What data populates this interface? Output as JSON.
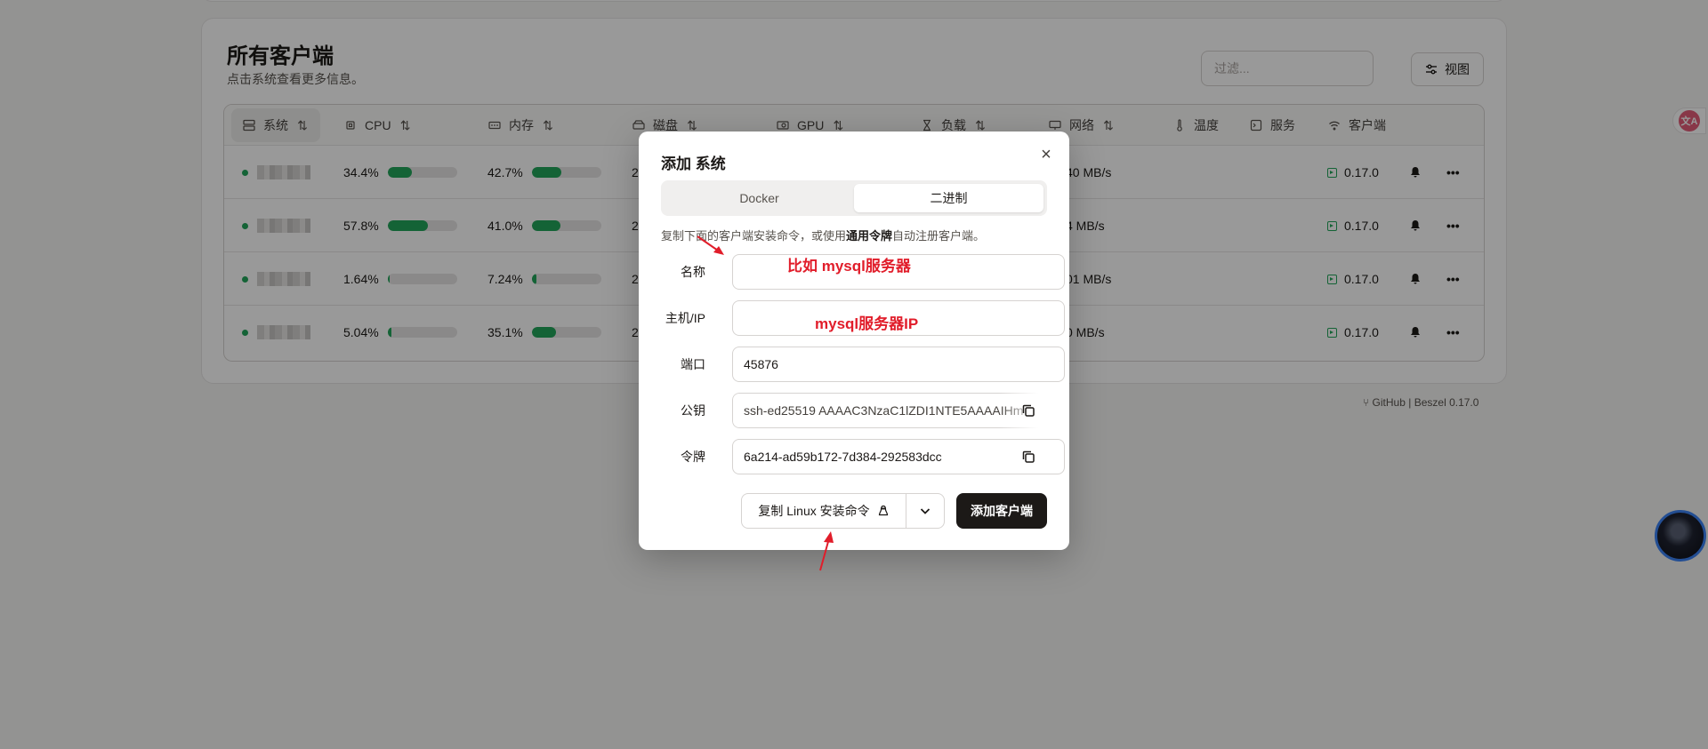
{
  "page": {
    "title": "所有客户端",
    "subtitle": "点击系统查看更多信息。",
    "filter_placeholder": "过滤...",
    "view_label": "视图"
  },
  "table": {
    "headers": [
      {
        "label": "系统",
        "icon": "server-icon",
        "sortable": true
      },
      {
        "label": "CPU",
        "icon": "cpu-icon",
        "sortable": true
      },
      {
        "label": "内存",
        "icon": "memory-icon",
        "sortable": true
      },
      {
        "label": "磁盘",
        "icon": "disk-icon",
        "sortable": true
      },
      {
        "label": "GPU",
        "icon": "gpu-icon",
        "sortable": true
      },
      {
        "label": "负载",
        "icon": "hourglass-icon",
        "sortable": true
      },
      {
        "label": "网络",
        "icon": "network-icon",
        "sortable": true
      },
      {
        "label": "温度",
        "icon": "thermometer-icon",
        "sortable": false
      },
      {
        "label": "服务",
        "icon": "service-icon",
        "sortable": false
      },
      {
        "label": "客户端",
        "icon": "wifi-icon",
        "sortable": false
      }
    ],
    "rows": [
      {
        "cpu": "34.4%",
        "cpu_pct": 34.4,
        "mem": "42.7%",
        "mem_pct": 42.7,
        "disk": "2",
        "net": "40 MB/s",
        "version": "0.17.0"
      },
      {
        "cpu": "57.8%",
        "cpu_pct": 57.8,
        "mem": "41.0%",
        "mem_pct": 41.0,
        "disk": "2",
        "net": "4 MB/s",
        "version": "0.17.0"
      },
      {
        "cpu": "1.64%",
        "cpu_pct": 1.64,
        "mem": "7.24%",
        "mem_pct": 7.24,
        "disk": "2",
        "net": "01 MB/s",
        "version": "0.17.0"
      },
      {
        "cpu": "5.04%",
        "cpu_pct": 5.04,
        "mem": "35.1%",
        "mem_pct": 35.1,
        "disk": "2",
        "net": "0 MB/s",
        "version": "0.17.0"
      }
    ]
  },
  "footer": {
    "github": "GitHub",
    "separator": "|",
    "version": "Beszel 0.17.0"
  },
  "dialog": {
    "title": "添加 系统",
    "tabs": [
      "Docker",
      "二进制"
    ],
    "active_tab": "二进制",
    "desc_before": "复制下面的客户端安装命令，或使用",
    "desc_bold": "通用令牌",
    "desc_after": "自动注册客户端。",
    "fields": {
      "name_label": "名称",
      "name_value": "",
      "host_label": "主机/IP",
      "host_value": "",
      "port_label": "端口",
      "port_value": "45876",
      "pubkey_label": "公钥",
      "pubkey_value": "ssh-ed25519 AAAAC3NzaC1lZDI1NTE5AAAAIHm",
      "token_label": "令牌",
      "token_value": "6a214-ad59b172-7d384-292583dcc"
    },
    "copy_button": "复制 Linux 安装命令",
    "add_button": "添加客户端"
  },
  "annotations": {
    "name_hint": "比如 mysql服务器",
    "host_hint": "mysql服务器IP"
  },
  "translate_badge": "文A",
  "colors": {
    "accent_green": "#22a55a",
    "annotation_red": "#e11d2a",
    "primary_dark": "#1c1917"
  }
}
